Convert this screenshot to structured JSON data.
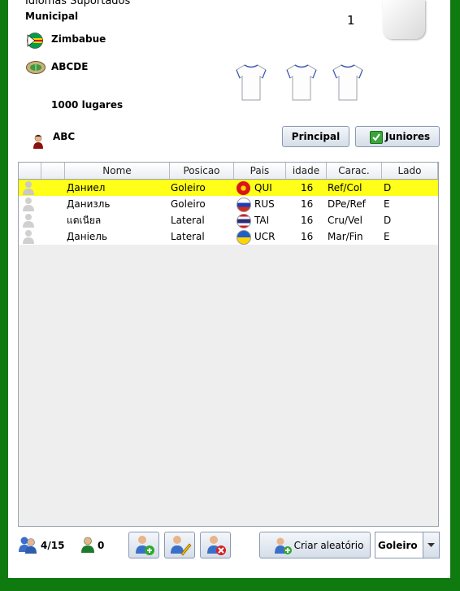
{
  "header": {
    "title_partial": "Idiomas Suportados",
    "stadium_label": "Municipal",
    "number": "1",
    "country": "Zimbabue",
    "stadium_name": "ABCDE",
    "capacity": "1000 lugares",
    "coach": "ABC"
  },
  "buttons": {
    "principal": "Principal",
    "juniores": "Juniores",
    "criar": "Criar aleatório",
    "position_select": "Goleiro"
  },
  "table": {
    "columns": [
      "",
      "",
      "Nome",
      "Posicao",
      "Pais",
      "idade",
      "Carac.",
      "Lado"
    ],
    "rows": [
      {
        "nome": "Даниел",
        "posicao": "Goleiro",
        "pais": "QUI",
        "idade": "16",
        "carac": "Ref/Col",
        "lado": "D",
        "selected": true,
        "flag": "kyrgyzstan"
      },
      {
        "nome": "Данизль",
        "posicao": "Goleiro",
        "pais": "RUS",
        "idade": "16",
        "carac": "DPe/Ref",
        "lado": "E",
        "selected": false,
        "flag": "russia"
      },
      {
        "nome": "แดเนียล",
        "posicao": "Lateral",
        "pais": "TAI",
        "idade": "16",
        "carac": "Cru/Vel",
        "lado": "D",
        "selected": false,
        "flag": "thailand"
      },
      {
        "nome": "Даніель",
        "posicao": "Lateral",
        "pais": "UCR",
        "idade": "16",
        "carac": "Mar/Fin",
        "lado": "E",
        "selected": false,
        "flag": "ukraine"
      }
    ]
  },
  "footer": {
    "players_count": "4/15",
    "extra_count": "0"
  },
  "icons": {
    "flag_zimbabwe": "zimbabwe-flag-icon",
    "stadium": "stadium-icon",
    "coach": "coach-icon",
    "shirt": "shirt-icon"
  }
}
